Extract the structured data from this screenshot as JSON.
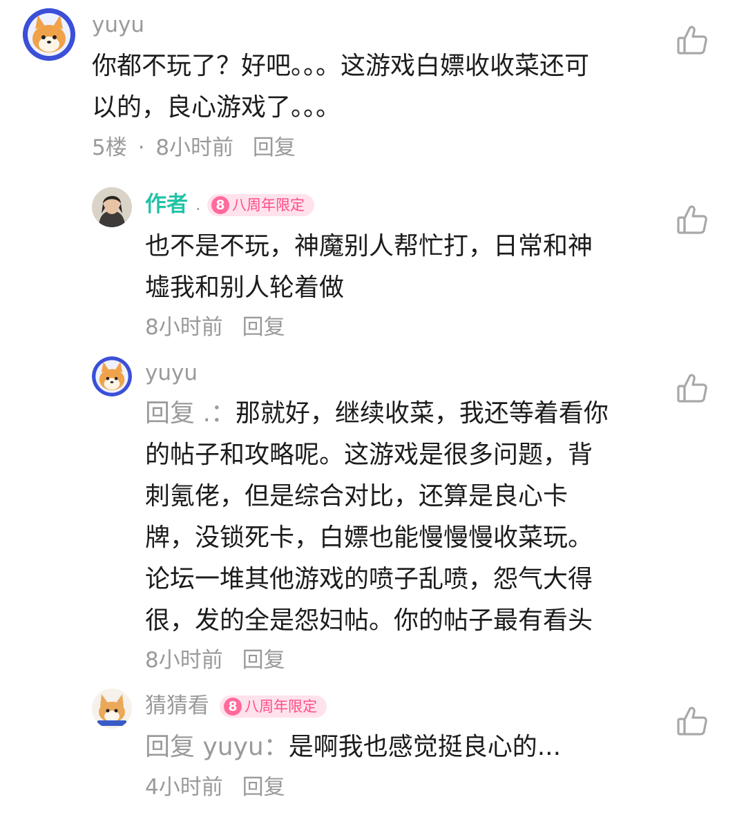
{
  "comment_main": {
    "username": "yuyu",
    "text_line1": "你都不玩了？好吧。。。这游戏白嫖收收菜还可",
    "text_line2": "以的，良心游戏了。。。",
    "floor": "5楼",
    "separator": "·",
    "time": "8小时前",
    "reply_label": "回复"
  },
  "reply_1": {
    "username": "作者",
    "name_suffix": ".",
    "badge": "八周年限定",
    "badge_number": "8",
    "text_line1": "也不是不玩，神魔别人帮忙打，日常和神",
    "text_line2": "墟我和别人轮着做",
    "time": "8小时前",
    "reply_label": "回复"
  },
  "reply_2": {
    "username": "yuyu",
    "reply_prefix": "回复 .：",
    "text_line1": "那就好，继续收菜，我还等着看你",
    "text_line2": "的帖子和攻略呢。这游戏是很多问题，背",
    "text_line3": "刺氪佬，但是综合对比，还算是良心卡",
    "text_line4": "牌，没锁死卡，白嫖也能慢慢慢收菜玩。",
    "text_line5": "论坛一堆其他游戏的喷子乱喷，怨气大得",
    "text_line6": "很，发的全是怨妇帖。你的帖子最有看头",
    "time": "8小时前",
    "reply_label": "回复"
  },
  "reply_3": {
    "username": "猜猜看",
    "badge": "八周年限定",
    "badge_number": "8",
    "reply_prefix": "回复 yuyu：",
    "text": "是啊我也感觉挺良心的...",
    "time": "4小时前",
    "reply_label": "回复"
  },
  "icons": {
    "like": "thumbs-up-icon",
    "avatar_shiba": "shiba-avatar",
    "avatar_author": "author-photo-avatar",
    "avatar_corgi": "corgi-avatar"
  },
  "colors": {
    "author_name": "#22c3a6",
    "muted": "#9a9a9a",
    "badge_bg": "#ffe2ec",
    "badge_fg": "#ff4d86"
  }
}
